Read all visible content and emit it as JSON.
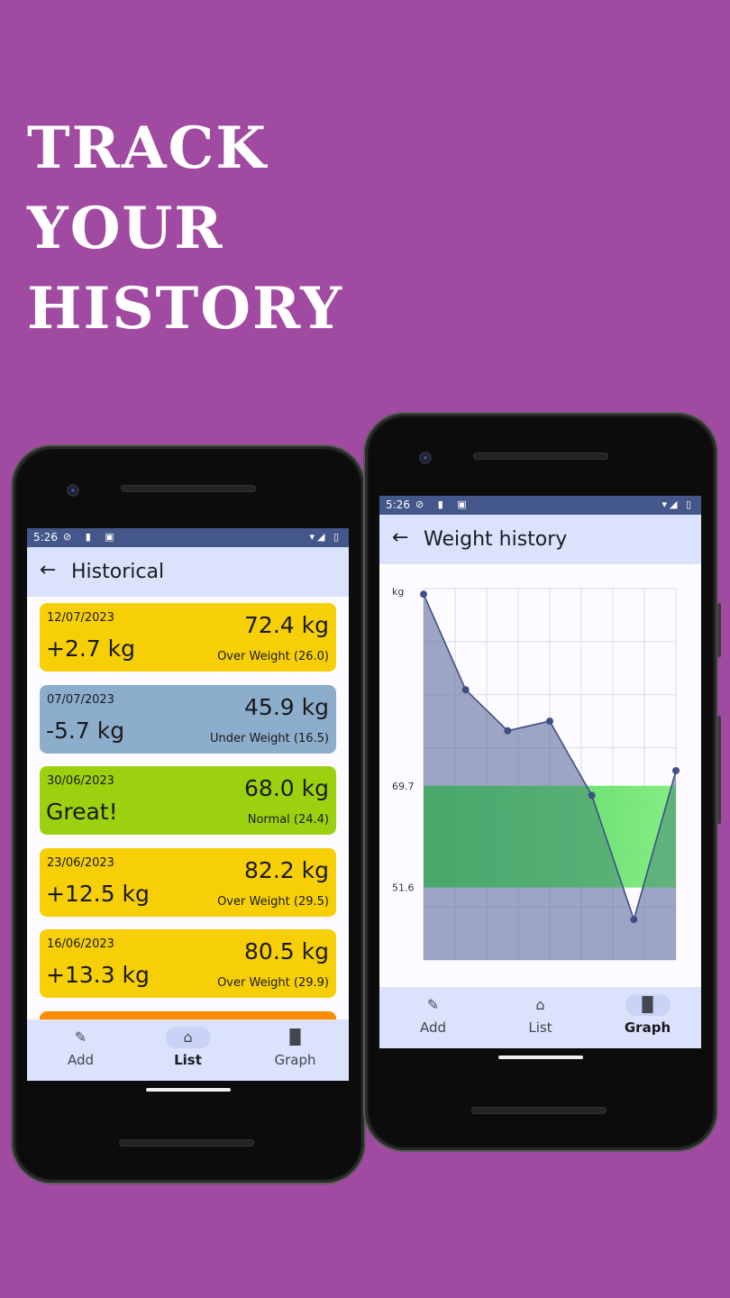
{
  "headline": [
    "TRACK",
    "YOUR",
    "HISTORY"
  ],
  "left_phone": {
    "status": {
      "time": "5:26",
      "left_icons": "⊘ ▮ ▣",
      "right_icons": "▾◢ ▯"
    },
    "appbar": {
      "back_icon": "arrow-left-icon",
      "back_glyph": "←",
      "title": "Historical"
    },
    "entries": [
      {
        "date": "12/07/2023",
        "delta": "+2.7 kg",
        "weight": "72.4 kg",
        "bmi": "Over Weight (26.0)",
        "color": "#f7cf07"
      },
      {
        "date": "07/07/2023",
        "delta": "-5.7 kg",
        "weight": "45.9 kg",
        "bmi": "Under Weight (16.5)",
        "color": "#8dadcd"
      },
      {
        "date": "30/06/2023",
        "delta": "Great!",
        "weight": "68.0 kg",
        "bmi": "Normal (24.4)",
        "color": "#9bd10f"
      },
      {
        "date": "23/06/2023",
        "delta": "+12.5 kg",
        "weight": "82.2 kg",
        "bmi": "Over Weight (29.5)",
        "color": "#f7cf07"
      },
      {
        "date": "16/06/2023",
        "delta": "+13.3 kg",
        "weight": "80.5 kg",
        "bmi": "Over Weight (29.9)",
        "color": "#f7cf07"
      }
    ],
    "partial_entry_color": "#ff8c00",
    "nav": [
      {
        "label": "Add",
        "icon": "pencil-icon",
        "glyph": "✎"
      },
      {
        "label": "List",
        "icon": "home-icon",
        "glyph": "⌂"
      },
      {
        "label": "Graph",
        "icon": "bar-chart-icon",
        "glyph": "▐▌"
      }
    ],
    "nav_active": "List"
  },
  "right_phone": {
    "status": {
      "time": "5:26",
      "left_icons": "⊘ ▮ ▣",
      "right_icons": "▾◢ ▯"
    },
    "appbar": {
      "back_icon": "arrow-left-icon",
      "back_glyph": "←",
      "title": "Weight history"
    },
    "nav": [
      {
        "label": "Add",
        "icon": "pencil-icon",
        "glyph": "✎"
      },
      {
        "label": "List",
        "icon": "home-icon",
        "glyph": "⌂"
      },
      {
        "label": "Graph",
        "icon": "bar-chart-icon",
        "glyph": "▐▌"
      }
    ],
    "nav_active": "Graph"
  },
  "chart_data": {
    "type": "area",
    "ylabel": "kg",
    "y_ticks": [
      {
        "value": 69.7,
        "label": "69.7"
      },
      {
        "value": 51.6,
        "label": "51.6"
      }
    ],
    "ylim": [
      38.7,
      104.8
    ],
    "normal_band": [
      51.6,
      69.7
    ],
    "series": [
      {
        "values": [
          103.8,
          86.8,
          79.5,
          81.2,
          68.0,
          45.9,
          72.4
        ]
      }
    ],
    "colors": {
      "line": "#3e4f86",
      "fill": "#4e5f96",
      "band": "#2ecc40",
      "band_bright": "#a8ff9a",
      "grid": "#dcdcdc"
    },
    "grid": true
  }
}
